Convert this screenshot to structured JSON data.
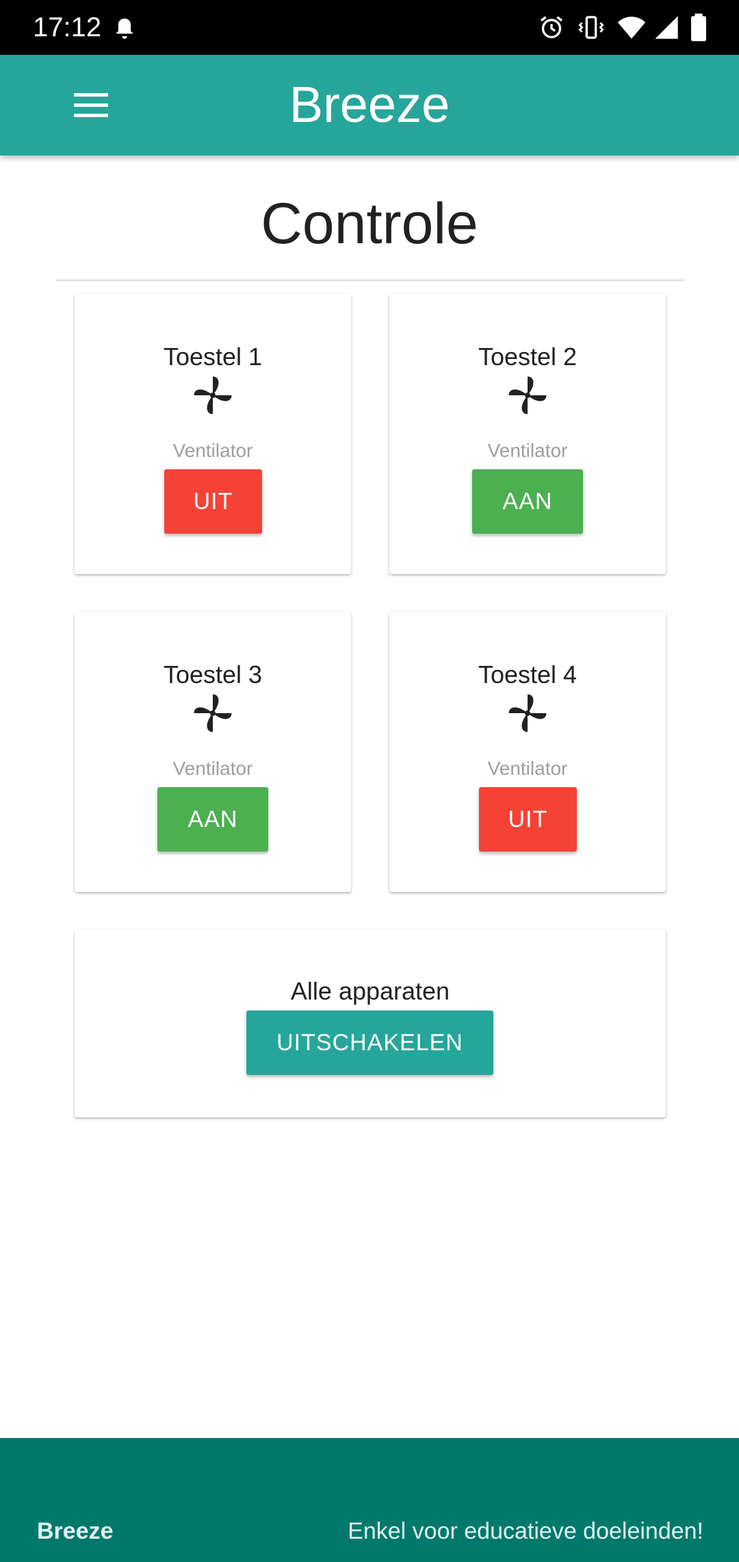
{
  "status_bar": {
    "time": "17:12",
    "icons": [
      "notification-bell-icon",
      "alarm-icon",
      "vibrate-icon",
      "wifi-icon",
      "signal-icon",
      "battery-icon"
    ]
  },
  "app_bar": {
    "title": "Breeze",
    "menu_icon": "hamburger-menu-icon",
    "color": "#26a69a"
  },
  "page": {
    "title": "Controle"
  },
  "devices": [
    {
      "name": "Toestel 1",
      "type": "Ventilator",
      "icon": "fan-icon",
      "button": "UIT",
      "state": "off"
    },
    {
      "name": "Toestel 2",
      "type": "Ventilator",
      "icon": "fan-icon",
      "button": "AAN",
      "state": "on"
    },
    {
      "name": "Toestel 3",
      "type": "Ventilator",
      "icon": "fan-icon",
      "button": "AAN",
      "state": "on"
    },
    {
      "name": "Toestel 4",
      "type": "Ventilator",
      "icon": "fan-icon",
      "button": "UIT",
      "state": "off"
    }
  ],
  "all_devices": {
    "label": "Alle apparaten",
    "button": "UITSCHAKELEN"
  },
  "footer": {
    "brand": "Breeze",
    "note": "Enkel voor educatieve doeleinden!",
    "color": "#00796b"
  },
  "colors": {
    "off_button": "#f44336",
    "on_button": "#4caf50",
    "accent": "#26a69a"
  }
}
